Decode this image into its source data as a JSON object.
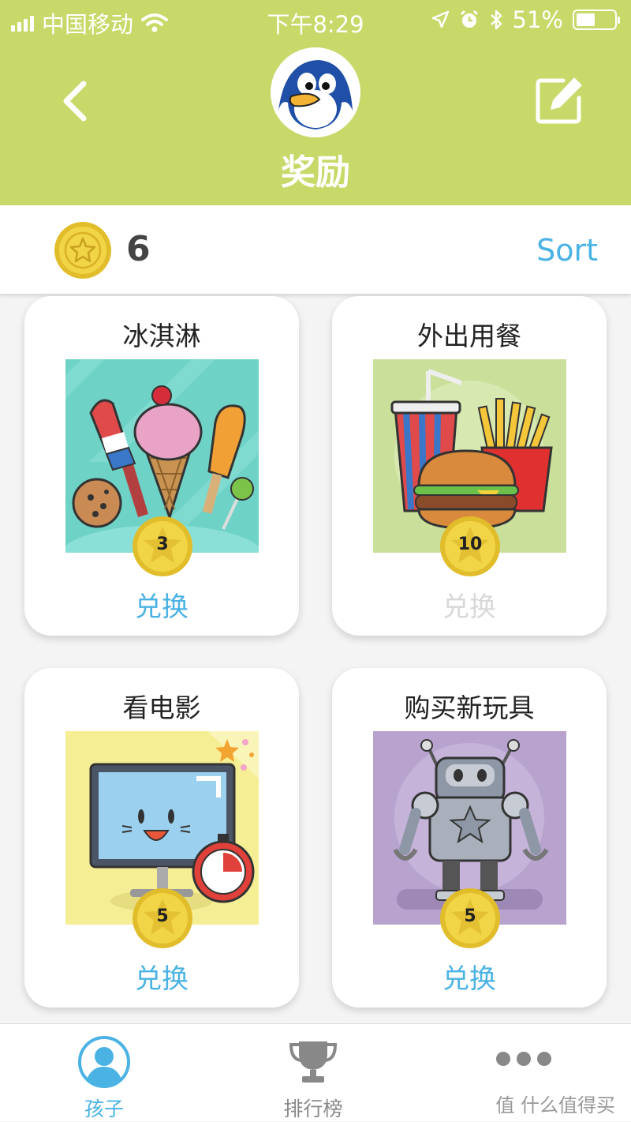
{
  "status_bar": {
    "carrier": "中国移动",
    "time": "下午8:29",
    "battery": "51%",
    "battery_level": 0.51
  },
  "header": {
    "title": "奖励",
    "back_icon": "chevron-left-icon",
    "edit_icon": "edit-icon"
  },
  "coins": {
    "count": "6",
    "sort_label": "Sort"
  },
  "rewards": [
    {
      "name": "冰淇淋",
      "cost": "3",
      "action": "兑换",
      "enabled": true
    },
    {
      "name": "外出用餐",
      "cost": "10",
      "action": "兑换",
      "enabled": false
    },
    {
      "name": "看电影",
      "cost": "5",
      "action": "兑换",
      "enabled": true
    },
    {
      "name": "购买新玩具",
      "cost": "5",
      "action": "兑换",
      "enabled": true
    }
  ],
  "tabs": [
    {
      "label": "孩子",
      "icon": "child-icon",
      "active": true
    },
    {
      "label": "排行榜",
      "icon": "trophy-icon",
      "active": false
    },
    {
      "label": "",
      "icon": "more-icon",
      "active": false
    }
  ],
  "watermark": "值 什么值得买",
  "colors": {
    "header": "#c8d969",
    "accent": "#4ab3e4",
    "coin": "#efcf3c"
  }
}
